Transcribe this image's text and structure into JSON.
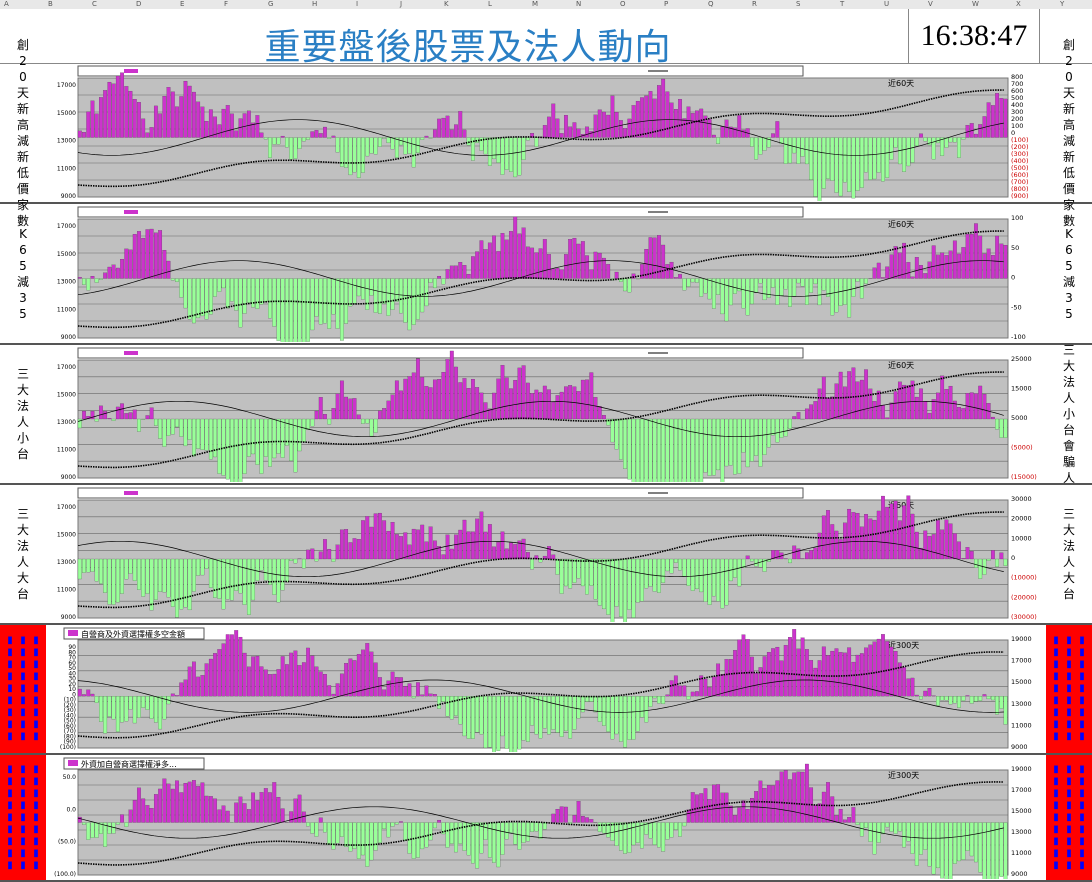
{
  "column_headers": [
    "A",
    "B",
    "C",
    "D",
    "E",
    "F",
    "G",
    "H",
    "I",
    "J",
    "K",
    "L",
    "M",
    "N",
    "O",
    "P",
    "Q",
    "R",
    "S",
    "T",
    "U",
    "V",
    "W",
    "X",
    "Y"
  ],
  "page_title": "重要盤後股票及法人動向",
  "clock": "16:38:47",
  "colors": {
    "title": "#2a7fc4",
    "plot_bg": "#c0c0c0",
    "pos_bar": "#cc33cc",
    "neg_bar": "#99ff99",
    "side_red": "#ff0000",
    "side_text_blue": "#0000ff"
  },
  "panels": [
    {
      "left_label": [
        "創",
        "2",
        "0",
        "天",
        "新",
        "高",
        "減",
        "新",
        "低",
        "價",
        "家",
        "數"
      ],
      "right_label": [
        "創",
        "2",
        "0",
        "天",
        "新",
        "高",
        "減",
        "新",
        "低",
        "價",
        "家",
        "數"
      ],
      "recent_tag": "近60天",
      "left_ticks": [
        "17000",
        "15000",
        "13000",
        "11000",
        "9000"
      ],
      "right_ticks": [
        "800",
        "700",
        "600",
        "500",
        "400",
        "300",
        "200",
        "100",
        "0",
        "(100)",
        "(200)",
        "(300)",
        "(400)",
        "(500)",
        "(600)",
        "(700)",
        "(800)",
        "(900)"
      ],
      "seed": 1
    },
    {
      "left_label": [
        "K",
        "6",
        "5",
        "減",
        "3",
        "5"
      ],
      "right_label": [
        "K",
        "6",
        "5",
        "減",
        "3",
        "5"
      ],
      "recent_tag": "近60天",
      "left_ticks": [
        "17000",
        "15000",
        "13000",
        "11000",
        "9000"
      ],
      "right_ticks": [
        "100",
        "50",
        "0",
        "-50",
        "-100"
      ],
      "seed": 2
    },
    {
      "left_label": [
        "三",
        "大",
        "法",
        "人",
        "小",
        "台"
      ],
      "right_label": [
        "三",
        "大",
        "法",
        "人",
        "小",
        "台",
        "會",
        "騙",
        "人"
      ],
      "recent_tag": "近60天",
      "left_ticks": [
        "17000",
        "15000",
        "13000",
        "11000",
        "9000"
      ],
      "right_ticks": [
        "25000",
        "15000",
        "5000",
        "(5000)",
        "(15000)"
      ],
      "seed": 3
    },
    {
      "left_label": [
        "三",
        "大",
        "法",
        "人",
        "大",
        "台"
      ],
      "right_label": [
        "三",
        "大",
        "法",
        "人",
        "大",
        "台"
      ],
      "recent_tag": "近60天",
      "left_ticks": [
        "17000",
        "15000",
        "13000",
        "11000",
        "9000"
      ],
      "right_ticks": [
        "30000",
        "20000",
        "10000",
        "0",
        "(10000)",
        "(20000)",
        "(30000)"
      ],
      "seed": 4
    },
    {
      "left_label": [],
      "right_label": [],
      "red": true,
      "legend": "自營商及外資選擇權多空金額",
      "recent_tag": "近300天",
      "left_ticks": [
        "90",
        "80",
        "70",
        "60",
        "50",
        "40",
        "30",
        "20",
        "10",
        "0",
        "(10)",
        "(20)",
        "(30)",
        "(40)",
        "(50)",
        "(60)",
        "(70)",
        "(80)",
        "(90)",
        "(100)"
      ],
      "right_ticks": [
        "19000",
        "17000",
        "15000",
        "13000",
        "11000",
        "9000"
      ],
      "seed": 5
    },
    {
      "left_label": [],
      "right_label": [],
      "red": true,
      "legend": "外資加自營商選擇權淨多...",
      "recent_tag": "近300天",
      "left_ticks": [
        "50.0",
        "0.0",
        "(50.0)",
        "(100.0)"
      ],
      "right_ticks": [
        "19000",
        "17000",
        "15000",
        "13000",
        "11000",
        "9000"
      ],
      "seed": 6
    }
  ]
}
